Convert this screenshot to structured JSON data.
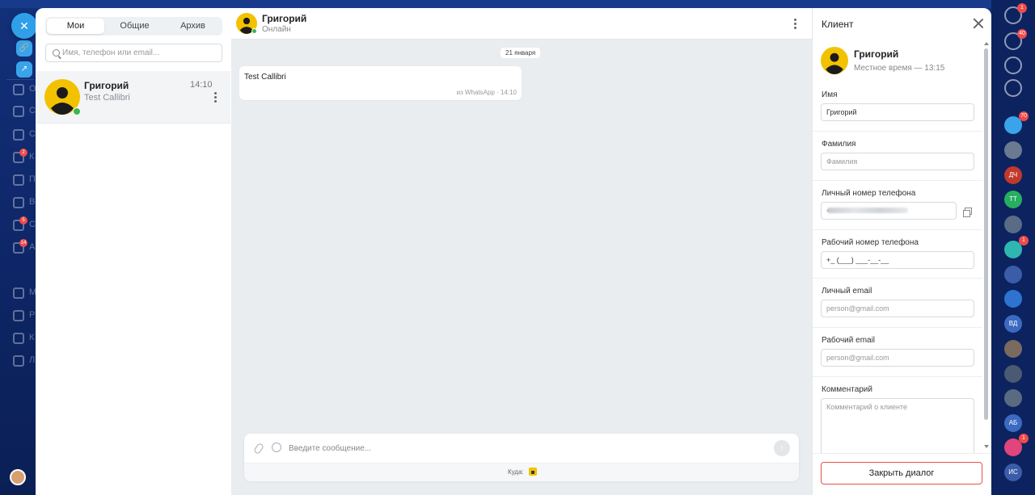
{
  "chat_list": {
    "tabs": [
      {
        "label": "Мои",
        "active": true
      },
      {
        "label": "Общие",
        "active": false
      },
      {
        "label": "Архив",
        "active": false
      }
    ],
    "search_placeholder": "Имя, телефон или email...",
    "items": [
      {
        "name": "Григорий",
        "preview": "Test Callibri",
        "time": "14:10",
        "online": true
      }
    ]
  },
  "conversation": {
    "contact_name": "Григорий",
    "status": "Онлайн",
    "date_separator": "21 января",
    "messages": [
      {
        "text": "Test Callibri",
        "meta": "из WhatsApp · 14:10"
      }
    ],
    "composer": {
      "placeholder": "Введите сообщение...",
      "route_label": "Куда:",
      "send_glyph": "↑"
    }
  },
  "client_panel": {
    "title": "Клиент",
    "name": "Григорий",
    "local_time": "Местное время — 13:15",
    "fields": {
      "first_name": {
        "label": "Имя",
        "value": "Григорий",
        "placeholder": ""
      },
      "last_name": {
        "label": "Фамилия",
        "value": "",
        "placeholder": "Фамилия"
      },
      "personal_phone": {
        "label": "Личный номер телефона",
        "value": "+"
      },
      "work_phone": {
        "label": "Рабочий номер телефона",
        "value": "+_ (___) ___-__-__"
      },
      "personal_email": {
        "label": "Личный email",
        "placeholder": "person@gmail.com"
      },
      "work_email": {
        "label": "Рабочий email",
        "placeholder": "person@gmail.com"
      },
      "comment": {
        "label": "Комментарий",
        "placeholder": "Комментарий о клиенте"
      }
    },
    "close_dialog_label": "Закрыть диалог"
  },
  "right_bar": {
    "badges": [
      "1",
      "40",
      "70",
      "1",
      "1",
      "1"
    ],
    "initials": [
      "ДЧ",
      "ТТ",
      "ВД",
      "АБ",
      "ИС"
    ]
  },
  "background_app": {
    "left_menu_fragments": [
      "О",
      "С",
      "С",
      "К",
      "П",
      "В",
      "С",
      "А",
      "М",
      "Р",
      "К",
      "Л"
    ],
    "left_badges": [
      "2",
      "5",
      "14"
    ],
    "close_glyph": "✕"
  },
  "colors": {
    "accent_yellow": "#f2c200",
    "online_green": "#41b34c",
    "danger_border": "#e8504a",
    "panel_bg": "#e9edf0"
  }
}
